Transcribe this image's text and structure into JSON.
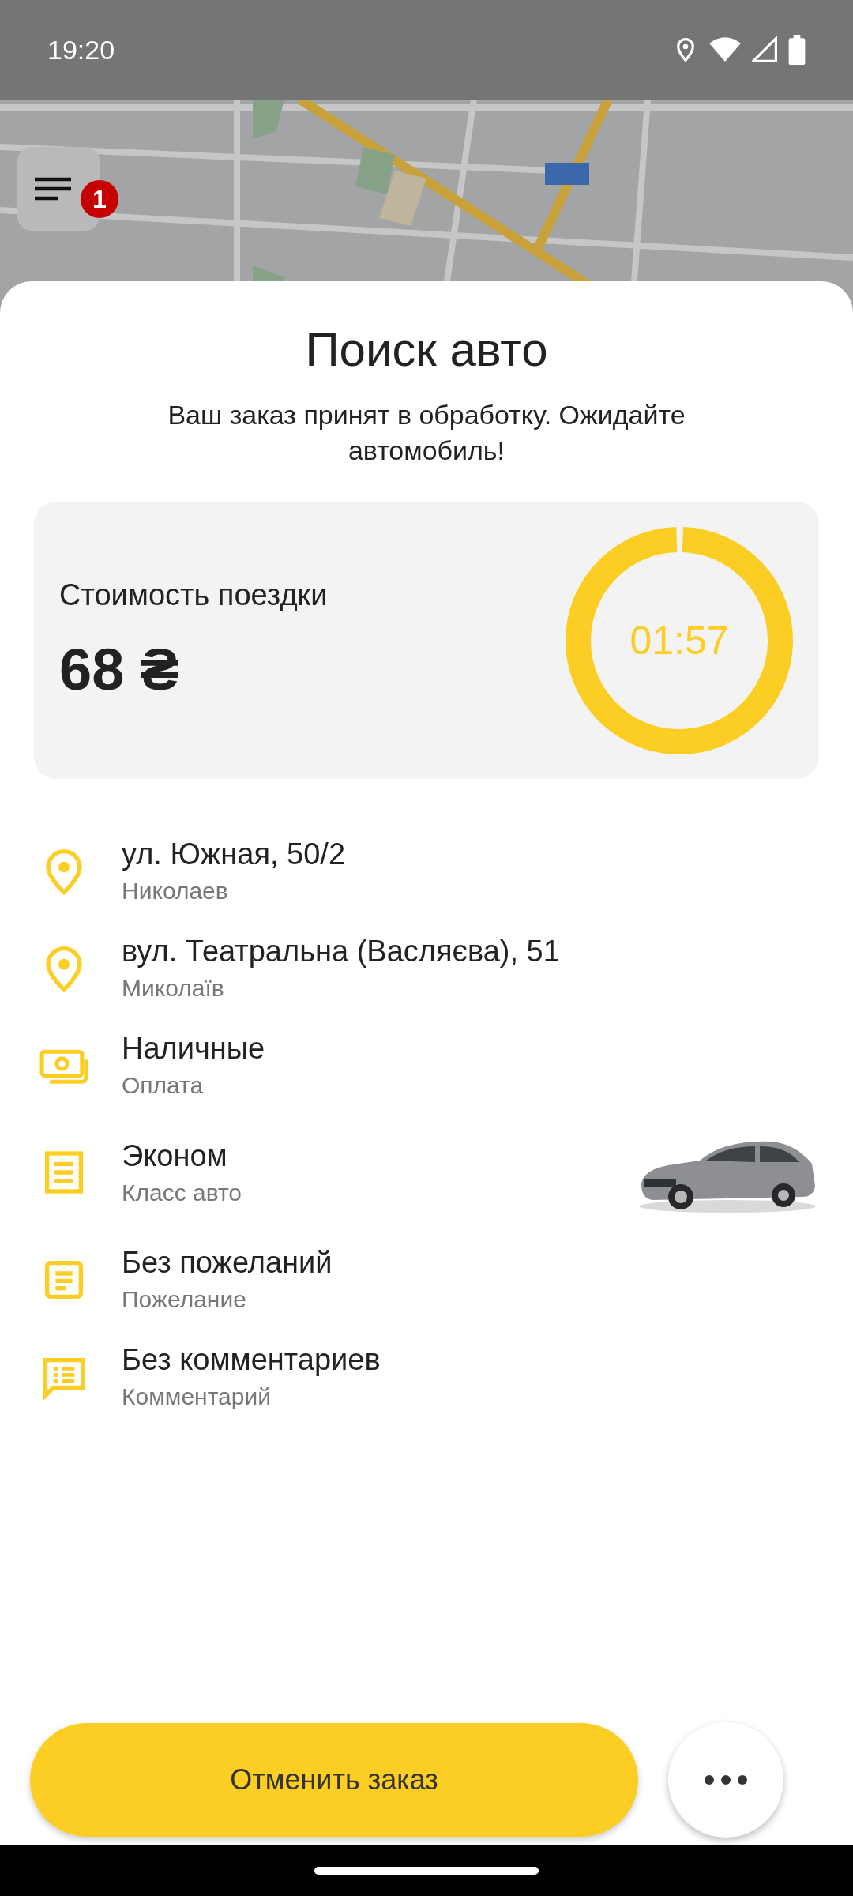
{
  "status_bar": {
    "time": "19:20"
  },
  "menu_button": {
    "badge": "1"
  },
  "title": "Поиск авто",
  "message": "Ваш заказ принят в обработку. Ожидайте автомобиль!",
  "fare": {
    "label": "Стоимость поездки",
    "price": "68 ₴",
    "timer": "01:57",
    "level": 0.99
  },
  "details": [
    {
      "kind": "pin",
      "title": "ул. Южная, 50/2",
      "subtitle": "Николаев"
    },
    {
      "kind": "pin",
      "title": "вул. Театральна (Васляєва), 51",
      "subtitle": "Миколаїв"
    },
    {
      "kind": "cash",
      "title": "Наличные",
      "subtitle": "Оплата"
    },
    {
      "kind": "car_class",
      "title": "Эконом",
      "subtitle": "Класс авто"
    },
    {
      "kind": "wish",
      "title": "Без пожеланий",
      "subtitle": "Пожелание"
    },
    {
      "kind": "comment",
      "title": "Без комментариев",
      "subtitle": "Комментарий"
    }
  ],
  "cancel_button": "Отменить заказ"
}
